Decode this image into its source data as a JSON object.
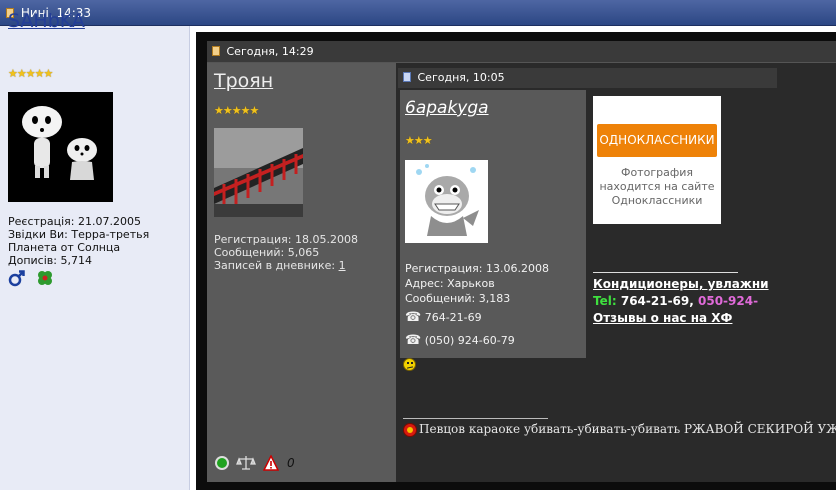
{
  "top_header": {
    "timestamp": "Нині, 14:33"
  },
  "left_user": {
    "name": "SAHbKA",
    "stars": "★★★★★",
    "info": {
      "registration": "Реєстрація: 21.07.2005",
      "from": "Звідки Ви: Терра-третья",
      "from2": "Планета от Солнца",
      "posts": "Дописів: 5,714"
    },
    "icons": [
      "male-icon",
      "clover-icon"
    ]
  },
  "middle_post": {
    "timestamp": "Сегодня, 14:29",
    "user": {
      "name": "Троян",
      "stars": "★★★★★",
      "info": {
        "registration": "Регистрация: 18.05.2008",
        "posts": "Сообщений: 5,065",
        "diary_label": "Записей в дневнике: ",
        "diary_count": "1"
      }
    },
    "bottom_icons": [
      "online-icon",
      "scales-icon",
      "warning-icon"
    ],
    "bottom_value": "0"
  },
  "nested_post": {
    "timestamp": "Сегодня, 10:05",
    "user": {
      "name": "6apakyga",
      "stars": "★★★",
      "info": {
        "registration": "Регистрация: 13.06.2008",
        "address": "Адрес: Харьков",
        "posts": "Сообщений: 3,183"
      },
      "phone1": "764-21-69",
      "phone2": "(050) 924-60-79"
    }
  },
  "ad": {
    "button_label": "ОДНОКЛАССНИКИ",
    "line1": "Фотография",
    "line2": "находится на сайте",
    "line3": "Одноклассники"
  },
  "signature": {
    "line1": "Кондиционеры, увлажни",
    "tel_label": "Tel:",
    "tel1": "764-21-69,",
    "tel2": "050-924-",
    "line3": "Отзывы о нас на ХФ"
  },
  "bottom_text": "Певцов караоке убивать-убивать-убивать РЖАВОЙ СЕКИРОЙ УЖОСА",
  "colors": {
    "header_bg": "#2c4784",
    "left_bg": "#e8ebf6",
    "name_link": "#243e97",
    "ok_orange": "#ee8208",
    "tel_green": "#3fe03f",
    "tel_pink": "#e06ad9"
  }
}
